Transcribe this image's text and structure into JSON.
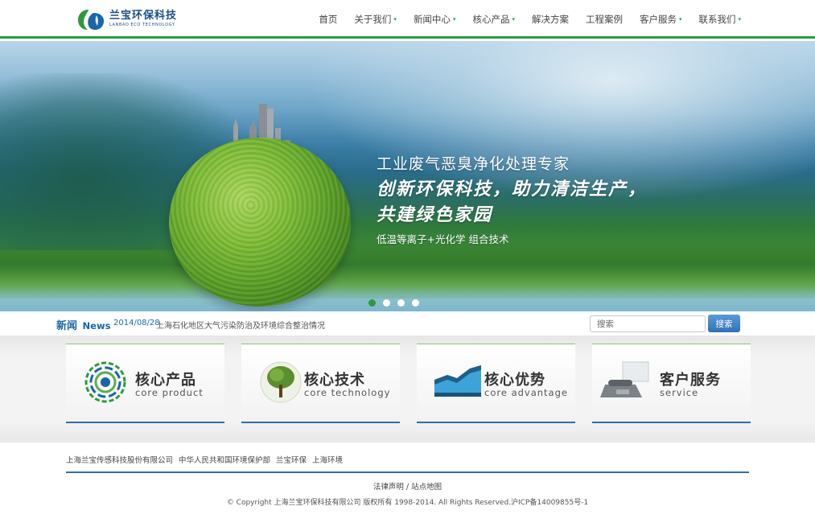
{
  "brand": {
    "name_cn": "兰宝环保科技",
    "name_en": "LANBAO ECO TECHNOLOGY",
    "colors": {
      "green": "#2e9a3c",
      "blue": "#1a66a8"
    }
  },
  "nav": {
    "items": [
      {
        "label": "首页",
        "has_dropdown": false
      },
      {
        "label": "关于我们",
        "has_dropdown": true
      },
      {
        "label": "新闻中心",
        "has_dropdown": true
      },
      {
        "label": "核心产品",
        "has_dropdown": true
      },
      {
        "label": "解决方案",
        "has_dropdown": false
      },
      {
        "label": "工程案例",
        "has_dropdown": false
      },
      {
        "label": "客户服务",
        "has_dropdown": true
      },
      {
        "label": "联系我们",
        "has_dropdown": true
      }
    ],
    "caret": "▾"
  },
  "banner": {
    "line1": "工业废气恶臭净化处理专家",
    "line2": "创新环保科技，助力清洁生产，",
    "line3": "共建绿色家园",
    "line4": "低温等离子+光化学 组合技术",
    "slides": 4,
    "active_slide": 1
  },
  "news": {
    "title_cn": "新闻",
    "title_en": "News",
    "date": "2014/08/28",
    "headline": "上海石化地区大气污染防治及环境综合整治情况"
  },
  "search": {
    "placeholder": "搜索",
    "button_label": "搜索"
  },
  "features": [
    {
      "cn": "核心产品",
      "en": "core product",
      "icon": "product-ring-icon"
    },
    {
      "cn": "核心技术",
      "en": "core technology",
      "icon": "tree-icon"
    },
    {
      "cn": "核心优势",
      "en": "core advantage",
      "icon": "chart-icon"
    },
    {
      "cn": "客户服务",
      "en": "service",
      "icon": "phone-icon"
    }
  ],
  "footer": {
    "links": [
      "上海兰宝传感科技股份有限公司",
      "中华人民共和国环境保护部",
      "兰宝环保",
      "上海环境"
    ],
    "legal": "法律声明",
    "sitemap": "站点地图",
    "separator": "/",
    "copyright": "© Copyright 上海兰宝环保科技有限公司 版权所有 1998-2014. All Rights Reserved.沪ICP备14009855号-1"
  }
}
